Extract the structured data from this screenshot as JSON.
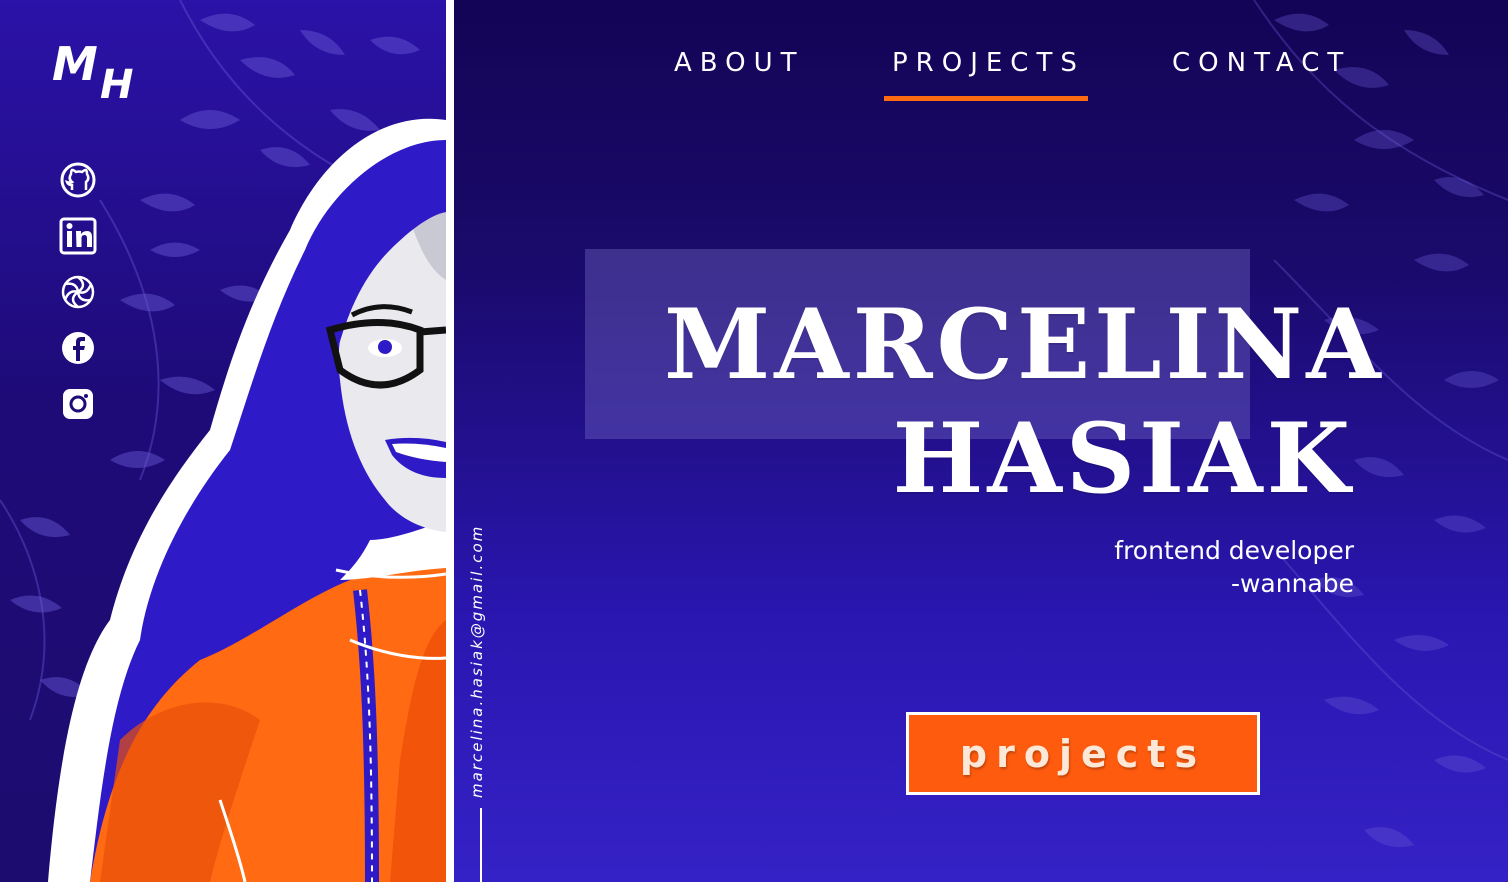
{
  "logo": {
    "text": "MH"
  },
  "socials": [
    {
      "name": "github",
      "icon": "github-icon"
    },
    {
      "name": "linkedin",
      "icon": "linkedin-icon"
    },
    {
      "name": "openai",
      "icon": "openai-icon"
    },
    {
      "name": "facebook",
      "icon": "facebook-icon"
    },
    {
      "name": "instagram",
      "icon": "instagram-icon"
    }
  ],
  "nav": {
    "items": [
      {
        "label": "ABOUT",
        "active": false
      },
      {
        "label": "PROJECTS",
        "active": true
      },
      {
        "label": "CONTACT",
        "active": false
      }
    ]
  },
  "contact": {
    "email": "marcelina.hasiak@gmail.com"
  },
  "hero": {
    "first_name": "MARCELINA",
    "last_name": "HASIAK",
    "subtitle_line1": "frontend developer",
    "subtitle_line2": "-wannabe"
  },
  "cta": {
    "label": "projects"
  },
  "colors": {
    "accent": "#ff6b13",
    "background_dark": "#140456",
    "background_light": "#3522c6",
    "text": "#ffffff"
  }
}
